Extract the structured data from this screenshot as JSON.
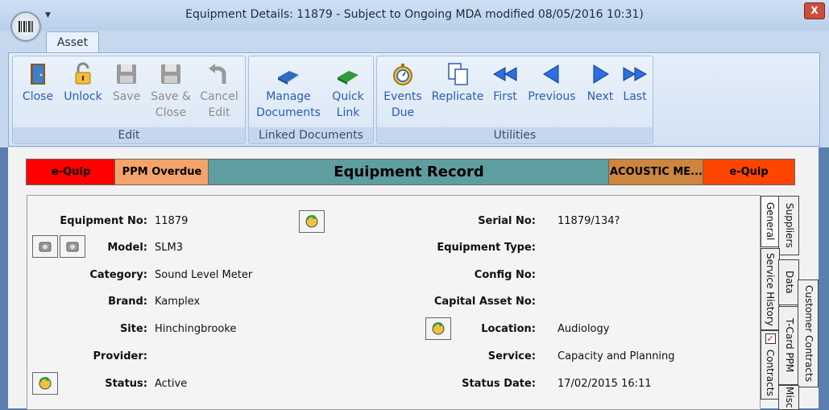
{
  "window": {
    "title": "Equipment Details: 11879 - Subject to Ongoing MDA modified 08/05/2016 10:31)",
    "close_label": "X"
  },
  "ribbon": {
    "tab": "Asset",
    "groups": {
      "edit": {
        "label": "Edit",
        "close": "Close",
        "unlock": "Unlock",
        "save": "Save",
        "save_close_1": "Save &",
        "save_close_2": "Close",
        "cancel_edit_1": "Cancel",
        "cancel_edit_2": "Edit"
      },
      "linked": {
        "label": "Linked Documents",
        "manage_1": "Manage",
        "manage_2": "Documents",
        "quick_1": "Quick",
        "quick_2": "Link"
      },
      "utilities": {
        "label": "Utilities",
        "events_1": "Events",
        "events_2": "Due",
        "replicate": "Replicate",
        "first": "First",
        "previous": "Previous",
        "next": "Next",
        "last": "Last"
      }
    }
  },
  "banner": {
    "left": "e-Quip",
    "ppm": "PPM Overdue",
    "center": "Equipment Record",
    "acoustic": "ACOUSTIC ME...",
    "right": "e-Quip",
    "colors": {
      "red": "#ff0000",
      "orange_light": "#f4a46a",
      "teal": "#5f9ea0",
      "brown": "#cd853f",
      "orange": "#ff4500"
    }
  },
  "form": {
    "left": {
      "equipment_no": {
        "label": "Equipment No:",
        "value": "11879"
      },
      "model": {
        "label": "Model:",
        "value": "SLM3"
      },
      "category": {
        "label": "Category:",
        "value": "Sound Level Meter"
      },
      "brand": {
        "label": "Brand:",
        "value": "Kamplex"
      },
      "site": {
        "label": "Site:",
        "value": "Hinchingbrooke"
      },
      "provider": {
        "label": "Provider:",
        "value": ""
      },
      "status": {
        "label": "Status:",
        "value": "Active"
      }
    },
    "right": {
      "serial_no": {
        "label": "Serial No:",
        "value": "11879/134?"
      },
      "equipment_type": {
        "label": "Equipment Type:",
        "value": ""
      },
      "config_no": {
        "label": "Config No:",
        "value": ""
      },
      "capital_asset_no": {
        "label": "Capital Asset No:",
        "value": ""
      },
      "location": {
        "label": "Location:",
        "value": "Audiology"
      },
      "service": {
        "label": "Service:",
        "value": "Capacity and Planning"
      },
      "status_date": {
        "label": "Status Date:",
        "value": "17/02/2015 16:11"
      }
    }
  },
  "side_tabs": {
    "general": "General",
    "suppliers": "Suppliers",
    "service_history": "Service History",
    "data": "Data",
    "contracts": "Contracts",
    "tcard_ppm": "T-Card PPM",
    "customer_contracts": "Customer Contracts",
    "misc": "Misc"
  }
}
